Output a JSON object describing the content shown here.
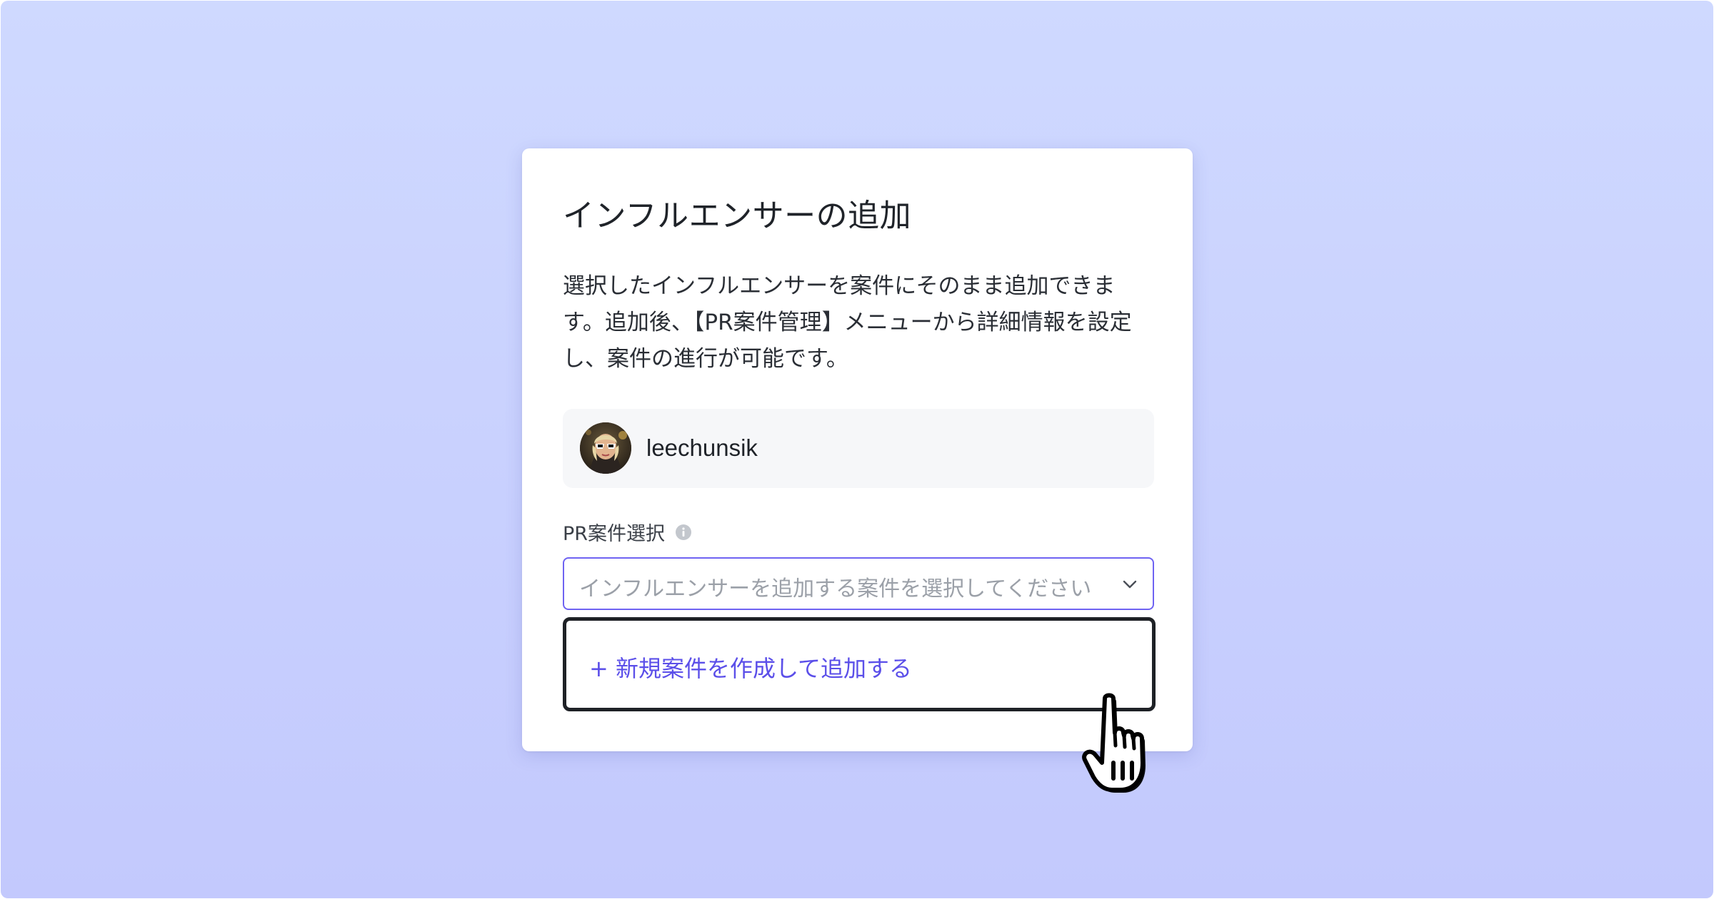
{
  "dialog": {
    "title": "インフルエンサーの追加",
    "description_lines": [
      "選択したインフルエンサーを案件にそのまま追加できま",
      "す。追加後、【PR案件管理】メニューから詳細情報を設定",
      "し、案件の進行が可能です。"
    ]
  },
  "influencer": {
    "username": "leechunsik",
    "avatar_icon": "user-avatar-photo"
  },
  "campaign_select": {
    "label": "PR案件選択",
    "info_icon": "info-icon",
    "placeholder": "インフルエンサーを追加する案件を選択してください",
    "chevron_icon": "chevron-down-icon",
    "border_color": "#6f63f2"
  },
  "dropdown": {
    "new_option_label": "+ 新規案件を作成して追加する",
    "accent_color": "#5b4fe9"
  },
  "cursor": {
    "icon": "hand-pointer-cursor"
  }
}
